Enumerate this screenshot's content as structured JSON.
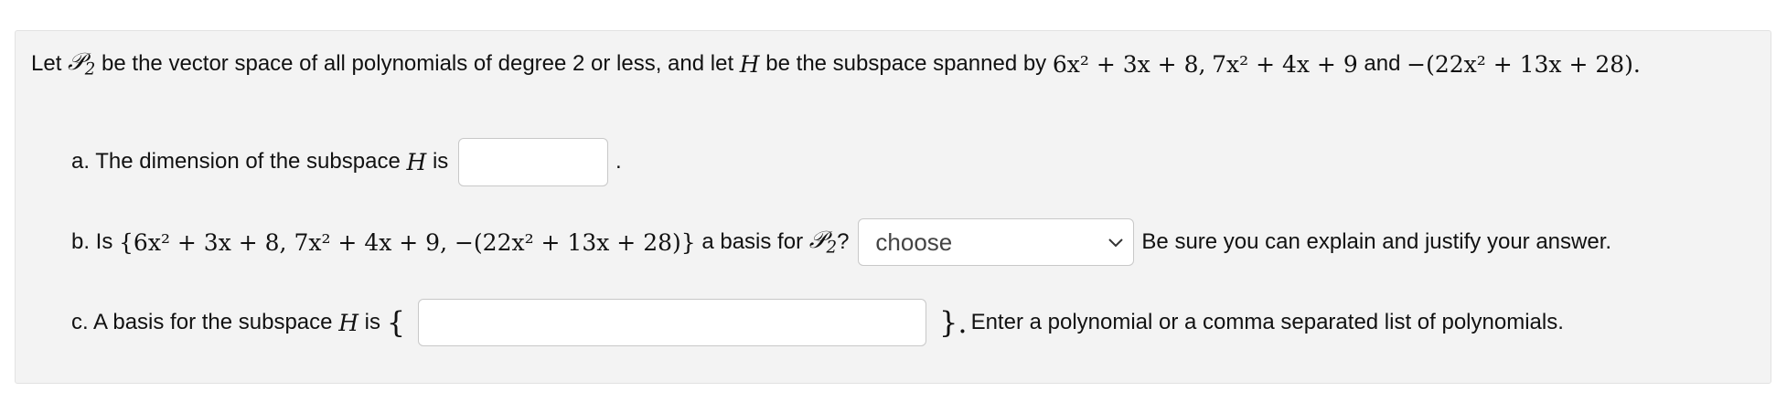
{
  "problem": {
    "intro_let": "Let",
    "p2_symbol": "𝒫",
    "p2_sub": "2",
    "intro_mid": "be the vector space of all polynomials of degree 2 or less, and let",
    "h_symbol": "H",
    "intro_spanned": "be the subspace spanned by",
    "poly1": "6x² + 3x + 8,",
    "poly2": "7x² + 4x + 9",
    "and_word": "and",
    "poly3": "−(22x² + 13x + 28).",
    "part_a": {
      "prefix": "a. The dimension of the subspace",
      "h_symbol": "H",
      "is_word": "is",
      "period": ".",
      "input_value": ""
    },
    "part_b": {
      "prefix": "b. Is",
      "set_expression": "{6x² + 3x + 8, 7x² + 4x + 9, −(22x² + 13x + 28)}",
      "basis_text": "a basis for",
      "p2_symbol": "𝒫",
      "p2_sub": "2",
      "question_mark": "?",
      "select_value": "choose",
      "suffix": "Be sure you can explain and justify your answer."
    },
    "part_c": {
      "prefix": "c. A basis for the subspace",
      "h_symbol": "H",
      "is_word": "is",
      "open_brace": "{",
      "close_brace": "}.",
      "input_value": "",
      "suffix": "Enter a polynomial or a comma separated list of polynomials."
    }
  },
  "colors": {
    "panel_bg": "#f3f3f3",
    "input_border": "#c8c8c8"
  },
  "icons": {
    "select_arrow": "chevron-down-icon"
  }
}
